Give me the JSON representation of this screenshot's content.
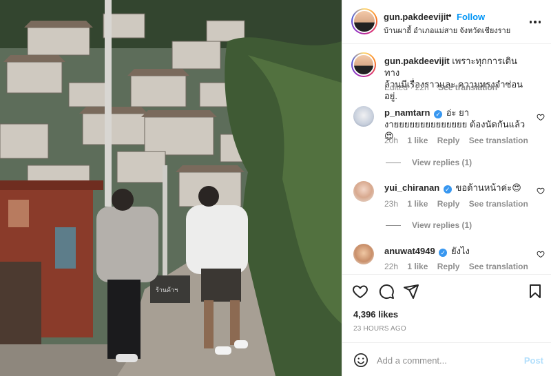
{
  "photo": {
    "sign_text": "ร้านค้าฯ"
  },
  "post": {
    "username": "gun.pakdeevijit",
    "follow_label": "Follow",
    "location": "บ้านผาฮี้ อำเภอแม่สาย จังหวัดเชียงราย",
    "caption_username": "gun.pakdeevijit",
    "caption_line1": "เพราะทุกการเดินทาง",
    "caption_line2": "ล้วนมีเรื่องราวและ ความทรงจำซ่อนอยู่.",
    "caption_edited": "Edited · 22h",
    "caption_translate": "See translation",
    "likes": "4,396 likes",
    "time_ago": "23 HOURS AGO"
  },
  "comments": [
    {
      "username": "p_namtarn",
      "text_line1": "อ่ะ ยา",
      "text_line2": "งายยยยยยยยยยยยยย ต้องนัดกันแล้ว😍",
      "time": "20h",
      "likes": "1 like",
      "reply": "Reply",
      "translate": "See translation",
      "view_replies": "View replies (1)"
    },
    {
      "username": "yui_chiranan",
      "text_line1": "ขอด้านหน้าค่ะ😍",
      "time": "23h",
      "likes": "1 like",
      "reply": "Reply",
      "translate": "See translation",
      "view_replies": "View replies (1)"
    },
    {
      "username": "anuwat4949",
      "text_line1": "ยังไง",
      "time": "22h",
      "likes": "1 like",
      "reply": "Reply",
      "translate": "See translation"
    }
  ],
  "add_comment": {
    "placeholder": "Add a comment...",
    "post_label": "Post"
  },
  "icons": {
    "more": "more-options-icon",
    "heart": "heart-icon",
    "comment": "comment-icon",
    "share": "share-icon",
    "save": "bookmark-icon",
    "emoji": "emoji-icon",
    "verified": "verified-badge-icon"
  },
  "colors": {
    "accent": "#0095f6",
    "verified": "#3897f0",
    "muted": "#8e8e8e",
    "post_disabled": "#b2dffc"
  }
}
